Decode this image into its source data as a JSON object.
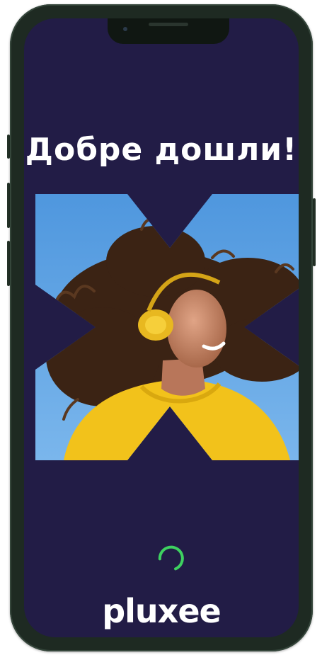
{
  "screen": {
    "background_color": "#221c46",
    "welcome_title": "Добре дошли!",
    "hero_image": {
      "icon": "x-shaped-photo-frame",
      "description_colors": {
        "sky": "#5a9fe0",
        "sweater": "#f2c21b",
        "hair": "#3a2214",
        "headphones": "#e8b820"
      }
    },
    "loading_indicator": {
      "icon": "loading-spinner-icon",
      "color": "#3ed160"
    },
    "brand_logo": "pluxee"
  }
}
